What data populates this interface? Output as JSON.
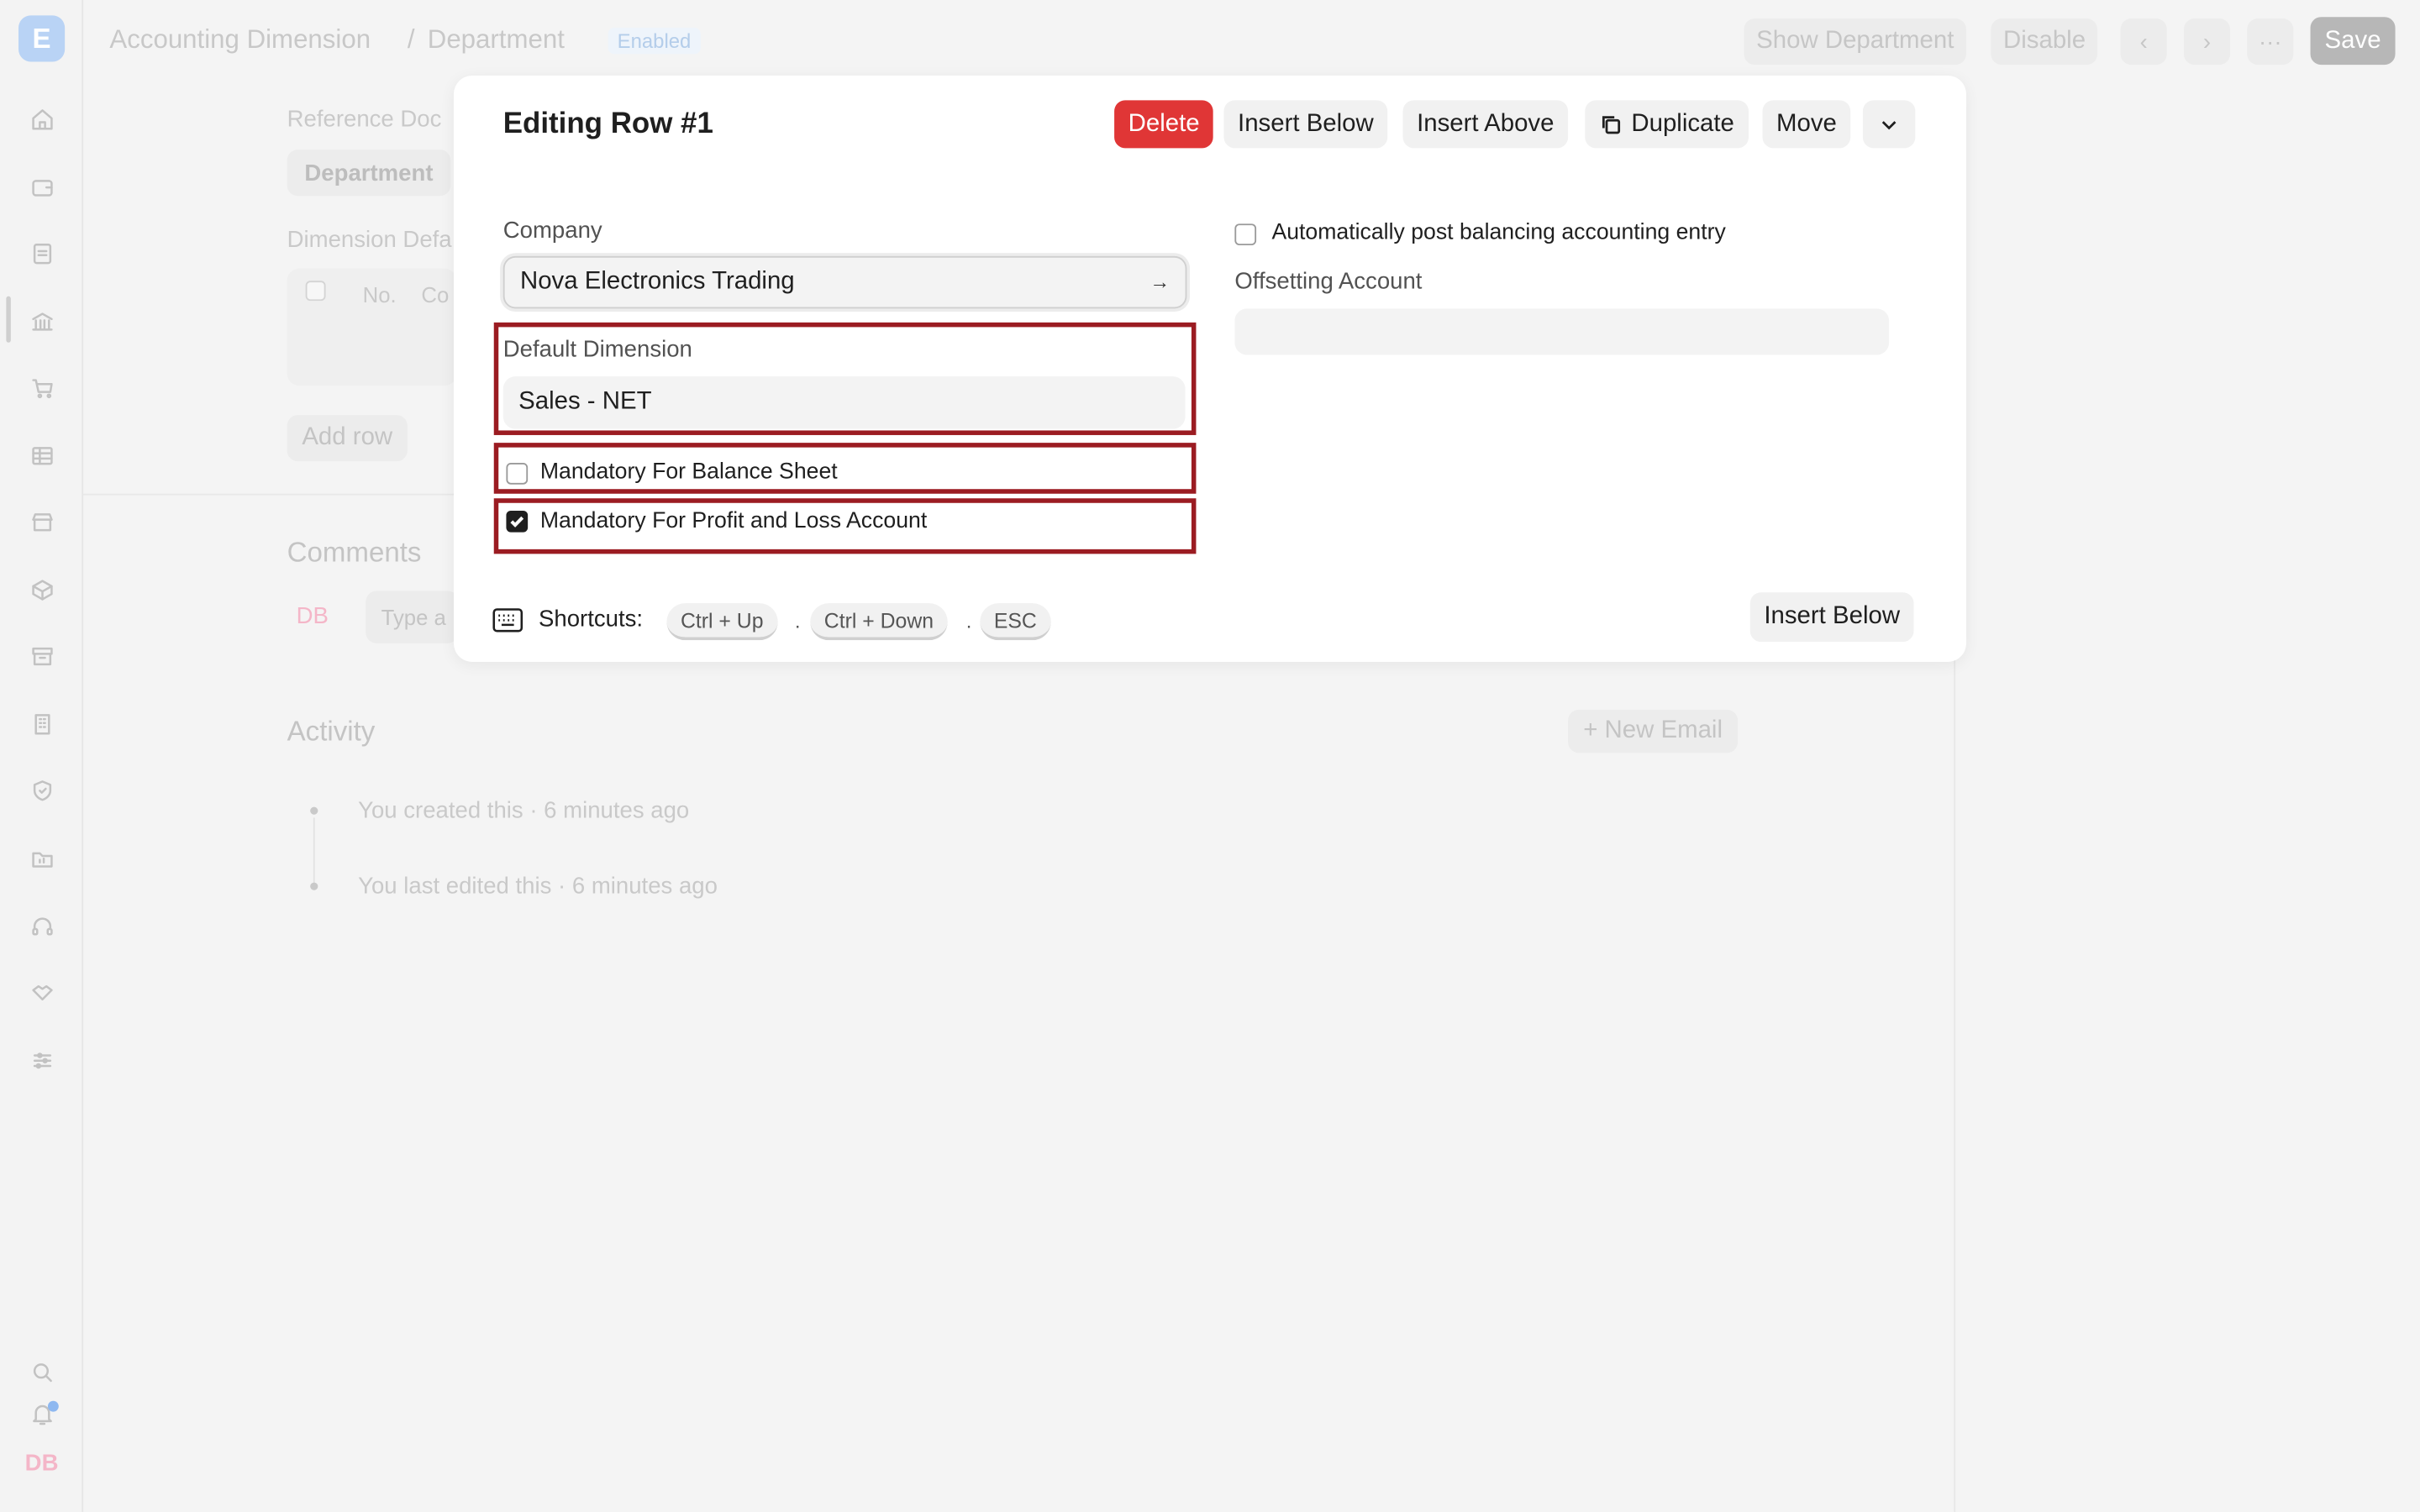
{
  "app": {
    "logo_letter": "E",
    "user_initials": "DB"
  },
  "header": {
    "breadcrumb_parent": "Accounting Dimension",
    "breadcrumb_separator": "/",
    "title": "Department",
    "status_badge": "Enabled",
    "show_department": "Show Department",
    "disable": "Disable",
    "save": "Save"
  },
  "sidebar": {
    "icons": [
      "home-icon",
      "wallet-icon",
      "file-icon",
      "bank-icon",
      "cart-icon",
      "table-icon",
      "store-icon",
      "box-icon",
      "archive-icon",
      "building-icon",
      "shield-icon",
      "folder-icon",
      "headset-icon",
      "handshake-icon",
      "sliders-icon"
    ],
    "bottom_icons": [
      "search-icon",
      "bell-icon"
    ]
  },
  "background": {
    "reference_document_label": "Reference Doc",
    "reference_document_value": "Department",
    "dimension_defaults_label": "Dimension Defa",
    "table_col_no": "No.",
    "table_col_company": "Co",
    "add_row": "Add row",
    "comments_heading": "Comments",
    "comment_placeholder": "Type a",
    "activity_heading": "Activity",
    "new_email": "+ New Email",
    "activity_items": [
      "You created this · 6 minutes ago",
      "You last edited this · 6 minutes ago"
    ]
  },
  "modal": {
    "title": "Editing Row #1",
    "buttons": {
      "delete": "Delete",
      "insert_below": "Insert Below",
      "insert_above": "Insert Above",
      "duplicate": "Duplicate",
      "move": "Move"
    },
    "company_label": "Company",
    "company_value": "Nova Electronics Trading",
    "default_dimension_label": "Default Dimension",
    "default_dimension_value": "Sales - NET",
    "mandatory_balance_sheet": "Mandatory For Balance Sheet",
    "mandatory_balance_sheet_checked": false,
    "mandatory_pnl": "Mandatory For Profit and Loss Account",
    "mandatory_pnl_checked": true,
    "auto_post_label": "Automatically post balancing accounting entry",
    "auto_post_checked": false,
    "offsetting_account_label": "Offsetting Account",
    "offsetting_account_value": "",
    "shortcuts_label": "Shortcuts:",
    "shortcuts": [
      "Ctrl + Up",
      "Ctrl + Down",
      "ESC"
    ],
    "shortcut_separator": ".",
    "footer_insert_below": "Insert Below"
  },
  "colors": {
    "delete_button": "#e03636",
    "highlight_border": "#9b1c22",
    "save_button_disabled": "#b7b7b7"
  }
}
